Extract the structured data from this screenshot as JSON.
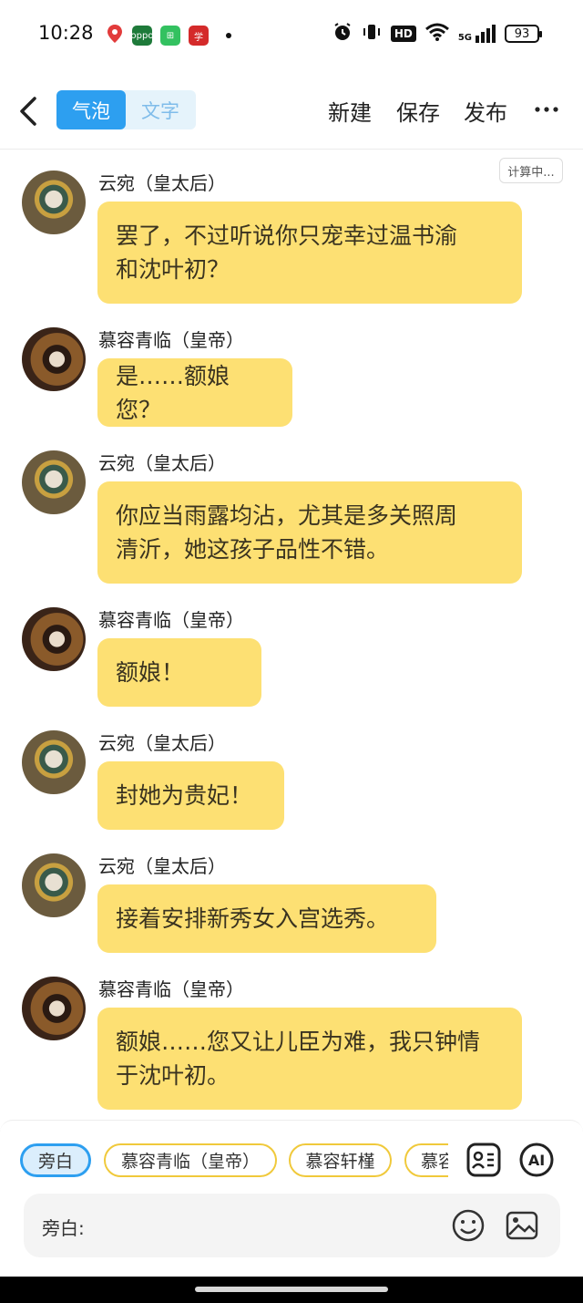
{
  "status_bar": {
    "time": "10:28",
    "battery": "93",
    "network": "5G",
    "hd": "HD",
    "notification_icons": [
      "location-pin-icon",
      "oppo-app-icon",
      "green-app-icon",
      "red-app-icon"
    ]
  },
  "header": {
    "back_icon": "chevron-left-icon",
    "tabs": [
      {
        "label": "气泡",
        "active": true
      },
      {
        "label": "文字",
        "active": false
      }
    ],
    "actions": {
      "new": "新建",
      "save": "保存",
      "publish": "发布"
    },
    "more_icon": "more-horizontal-icon"
  },
  "status_badge": "计算中...",
  "messages": [
    {
      "speaker": "云宛（皇太后）",
      "role": "empress",
      "lines": [
        "罢了，不过听说你只宠幸过温书渝",
        "和沈叶初？"
      ]
    },
    {
      "speaker": "慕容青临（皇帝）",
      "role": "emperor",
      "lines": [
        "是……额娘您？"
      ]
    },
    {
      "speaker": "云宛（皇太后）",
      "role": "empress",
      "lines": [
        "你应当雨露均沾，尤其是多关照周",
        "清沂，她这孩子品性不错。"
      ]
    },
    {
      "speaker": "慕容青临（皇帝）",
      "role": "emperor",
      "lines": [
        "额娘！"
      ]
    },
    {
      "speaker": "云宛（皇太后）",
      "role": "empress",
      "lines": [
        "封她为贵妃！"
      ]
    },
    {
      "speaker": "云宛（皇太后）",
      "role": "empress",
      "lines": [
        "接着安排新秀女入宫选秀。"
      ]
    },
    {
      "speaker": "慕容青临（皇帝）",
      "role": "emperor",
      "lines": [
        "额娘……您又让儿臣为难，我只钟情",
        "于沈叶初。"
      ]
    }
  ],
  "role_chips": [
    "旁白",
    "慕容青临（皇帝）",
    "慕容轩槿",
    "慕容"
  ],
  "tools": {
    "character_card_icon": "character-card-icon",
    "ai_label": "AI"
  },
  "input": {
    "label": "旁白:",
    "emoji_icon": "emoji-icon",
    "image_icon": "image-icon"
  },
  "colors": {
    "accent": "#2d9ff0",
    "bubble": "#fde073",
    "chip_border": "#f0c93b"
  }
}
